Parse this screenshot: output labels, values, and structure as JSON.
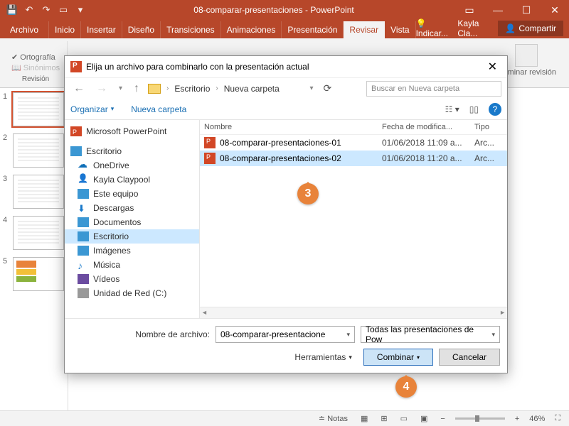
{
  "titlebar": {
    "title": "08-comparar-presentaciones - PowerPoint"
  },
  "ribbon": {
    "file": "Archivo",
    "tabs": [
      "Inicio",
      "Insertar",
      "Diseño",
      "Transiciones",
      "Animaciones",
      "Presentación",
      "Revisar",
      "Vista"
    ],
    "active_index": 6,
    "tell_me": "Indicar...",
    "user": "Kayla Cla...",
    "share": "Compartir",
    "group_proof_items": [
      "Ortografía",
      "Sinónimos"
    ],
    "group_proof_label": "Revisión",
    "end_label": "Terminar revisión"
  },
  "thumbs": [
    "1",
    "2",
    "3",
    "4",
    "5"
  ],
  "statusbar": {
    "notes": "Notas",
    "zoom": "46%"
  },
  "dialog": {
    "title": "Elija un archivo para combinarlo con la presentación actual",
    "crumbs": [
      "Escritorio",
      "Nueva carpeta"
    ],
    "search_placeholder": "Buscar en Nueva carpeta",
    "toolbar": {
      "organize": "Organizar",
      "newfolder": "Nueva carpeta"
    },
    "tree_top": "Microsoft PowerPoint",
    "tree_desktop": "Escritorio",
    "tree_items": [
      {
        "label": "OneDrive",
        "icon": "ico-cloud"
      },
      {
        "label": "Kayla Claypool",
        "icon": "ico-user"
      },
      {
        "label": "Este equipo",
        "icon": "ico-pc"
      },
      {
        "label": "Descargas",
        "icon": "ico-dl"
      },
      {
        "label": "Documentos",
        "icon": "ico-doc"
      },
      {
        "label": "Escritorio",
        "icon": "ico-desk",
        "selected": true
      },
      {
        "label": "Imágenes",
        "icon": "ico-img"
      },
      {
        "label": "Música",
        "icon": "ico-mus"
      },
      {
        "label": "Vídeos",
        "icon": "ico-vid"
      },
      {
        "label": "Unidad de Red (C:)",
        "icon": "ico-drv"
      }
    ],
    "columns": {
      "name": "Nombre",
      "date": "Fecha de modifica...",
      "type": "Tipo"
    },
    "files": [
      {
        "name": "08-comparar-presentaciones-01",
        "date": "01/06/2018 11:09 a...",
        "type": "Arc..."
      },
      {
        "name": "08-comparar-presentaciones-02",
        "date": "01/06/2018 11:20 a...",
        "type": "Arc...",
        "selected": true
      }
    ],
    "filename_label": "Nombre de archivo:",
    "filename_value": "08-comparar-presentacione",
    "filter_value": "Todas las presentaciones de Pow",
    "tools": "Herramientas",
    "combine": "Combinar",
    "cancel": "Cancelar"
  },
  "callouts": {
    "c3": "3",
    "c4": "4"
  }
}
